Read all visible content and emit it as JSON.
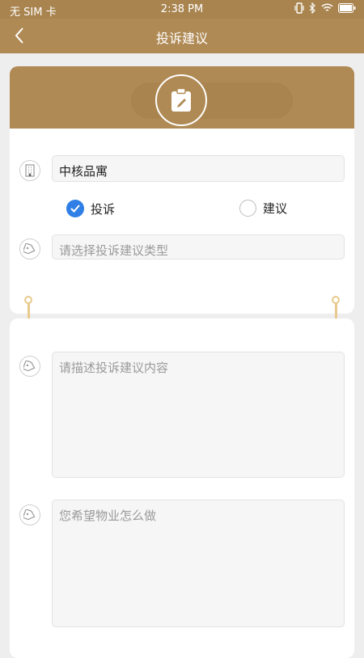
{
  "status_bar": {
    "carrier": "无 SIM 卡",
    "time": "2:38 PM"
  },
  "header": {
    "title": "投诉建议"
  },
  "form": {
    "property": {
      "value": "中核品寓"
    },
    "type_options": [
      {
        "label": "投诉",
        "selected": true
      },
      {
        "label": "建议",
        "selected": false
      }
    ],
    "category": {
      "placeholder": "请选择投诉建议类型"
    },
    "description": {
      "placeholder": "请描述投诉建议内容"
    },
    "expectation": {
      "placeholder": "您希望物业怎么做"
    }
  },
  "colors": {
    "brand": "#b08a55",
    "status_bar": "#a9844f",
    "accent": "#2f7fe6",
    "ring": "#e9c98d"
  },
  "icons": {
    "property": "building-icon",
    "category": "tag-icon",
    "description": "tag-icon",
    "expectation": "tag-icon"
  }
}
